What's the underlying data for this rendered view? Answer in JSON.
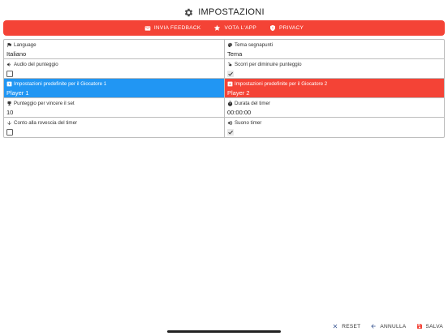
{
  "app": {
    "title": "IMPOSTAZIONI",
    "icon": "gear-icon"
  },
  "colors": {
    "action_bar": "#f44336",
    "player1": "#2196f3",
    "player2": "#f44336",
    "save": "#f44336"
  },
  "actions": {
    "feedback": {
      "label": "INVIA FEEDBACK",
      "icon": "mail-icon"
    },
    "rate": {
      "label": "VOTA L'APP",
      "icon": "star-icon"
    },
    "privacy": {
      "label": "PRIVACY",
      "icon": "shield-icon"
    }
  },
  "settings": {
    "language": {
      "label": "Language",
      "value": "Italiano",
      "icon": "flag-icon"
    },
    "theme": {
      "label": "Tema segnapunti",
      "value": "Tema",
      "icon": "palette-icon"
    },
    "score_audio": {
      "label": "Audio del punteggio",
      "checked": false,
      "icon": "speaker-icon"
    },
    "swipe_decrease": {
      "label": "Scorri per diminuire punteggio",
      "checked": true,
      "icon": "swipe-icon"
    },
    "player1_default": {
      "label": "Impostazioni predefinite per il Giocatore 1",
      "value": "Player 1",
      "icon": "player-one-icon"
    },
    "player2_default": {
      "label": "Impostazioni predefinite per il Giocatore 2",
      "value": "Player 2",
      "icon": "player-two-icon"
    },
    "points_to_win_set": {
      "label": "Punteggio per vincere il set",
      "value": "10",
      "icon": "trophy-icon"
    },
    "timer_duration": {
      "label": "Durata del timer",
      "value": "00:00:00",
      "icon": "timer-icon"
    },
    "timer_countdown": {
      "label": "Conto alla rovescia del timer",
      "checked": false,
      "icon": "arrow-down-icon"
    },
    "timer_sound": {
      "label": "Suono timer",
      "checked": true,
      "icon": "speaker-icon"
    }
  },
  "footer": {
    "reset": {
      "label": "RESET",
      "icon": "close-icon"
    },
    "cancel": {
      "label": "ANNULLA",
      "icon": "arrow-left-icon"
    },
    "save": {
      "label": "SALVA",
      "icon": "save-icon"
    }
  }
}
